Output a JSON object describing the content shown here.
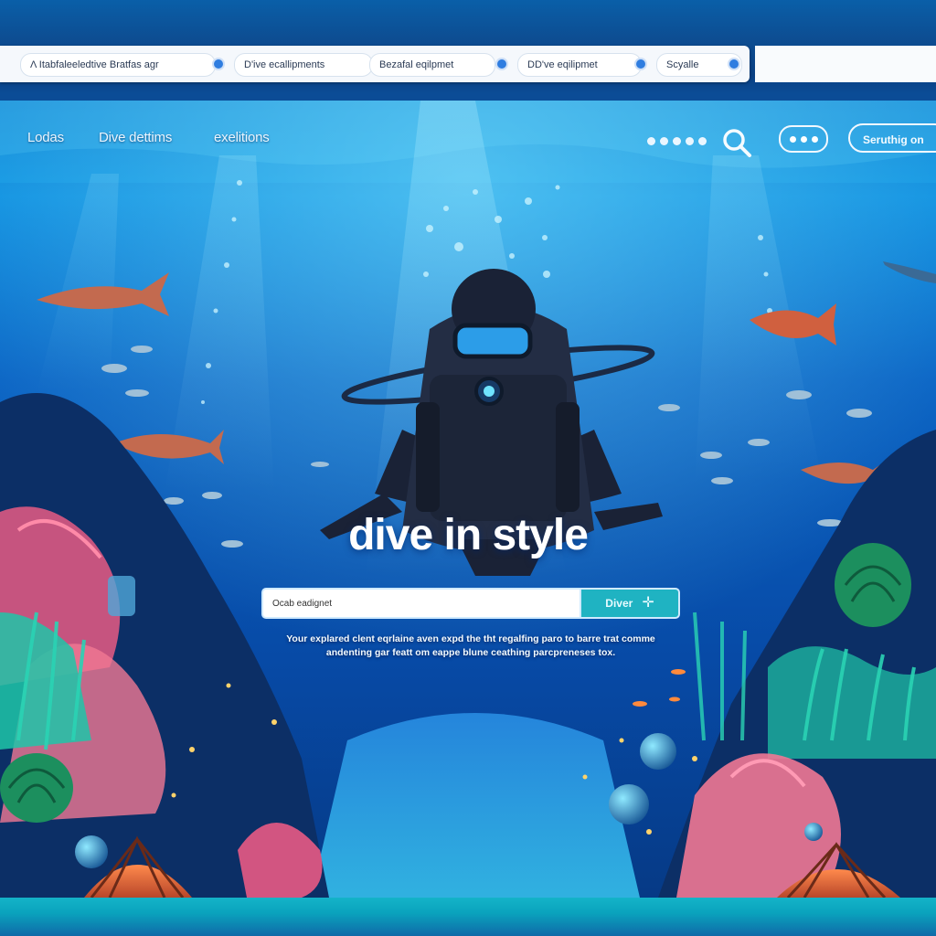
{
  "tabs": [
    {
      "label": "Λ Itabfaleeledtive Bratfas agr"
    },
    {
      "label": "D'ive ecallipments"
    },
    {
      "label": "Bezafal eqilpmet"
    },
    {
      "label": "DD've eqilipmet"
    },
    {
      "label": "Scyalle"
    }
  ],
  "nav": {
    "links": [
      "Lodas",
      "Dive dettims",
      "exelitions"
    ],
    "cta_label": "Seruthig on"
  },
  "icons": {
    "search": "search-icon",
    "menu": "more-dots-icon",
    "dive": "plus-icon",
    "tab_dot": "dot-icon"
  },
  "hero": {
    "title": "dive in style",
    "search_value": "Ocab eadignet",
    "dive_button_label": "Diver",
    "description": "Your explared clent eqrlaine aven expd the tht regalfing paro to barre trat comme andenting gar featt om eappe blune ceathing parcpreneses tox."
  },
  "colors": {
    "accent": "#1fb3c2",
    "ocean_top": "#0f7fd6",
    "ocean_deep": "#063a86",
    "coral": "#ff6f8e",
    "tab_dot": "#2f7de0"
  }
}
